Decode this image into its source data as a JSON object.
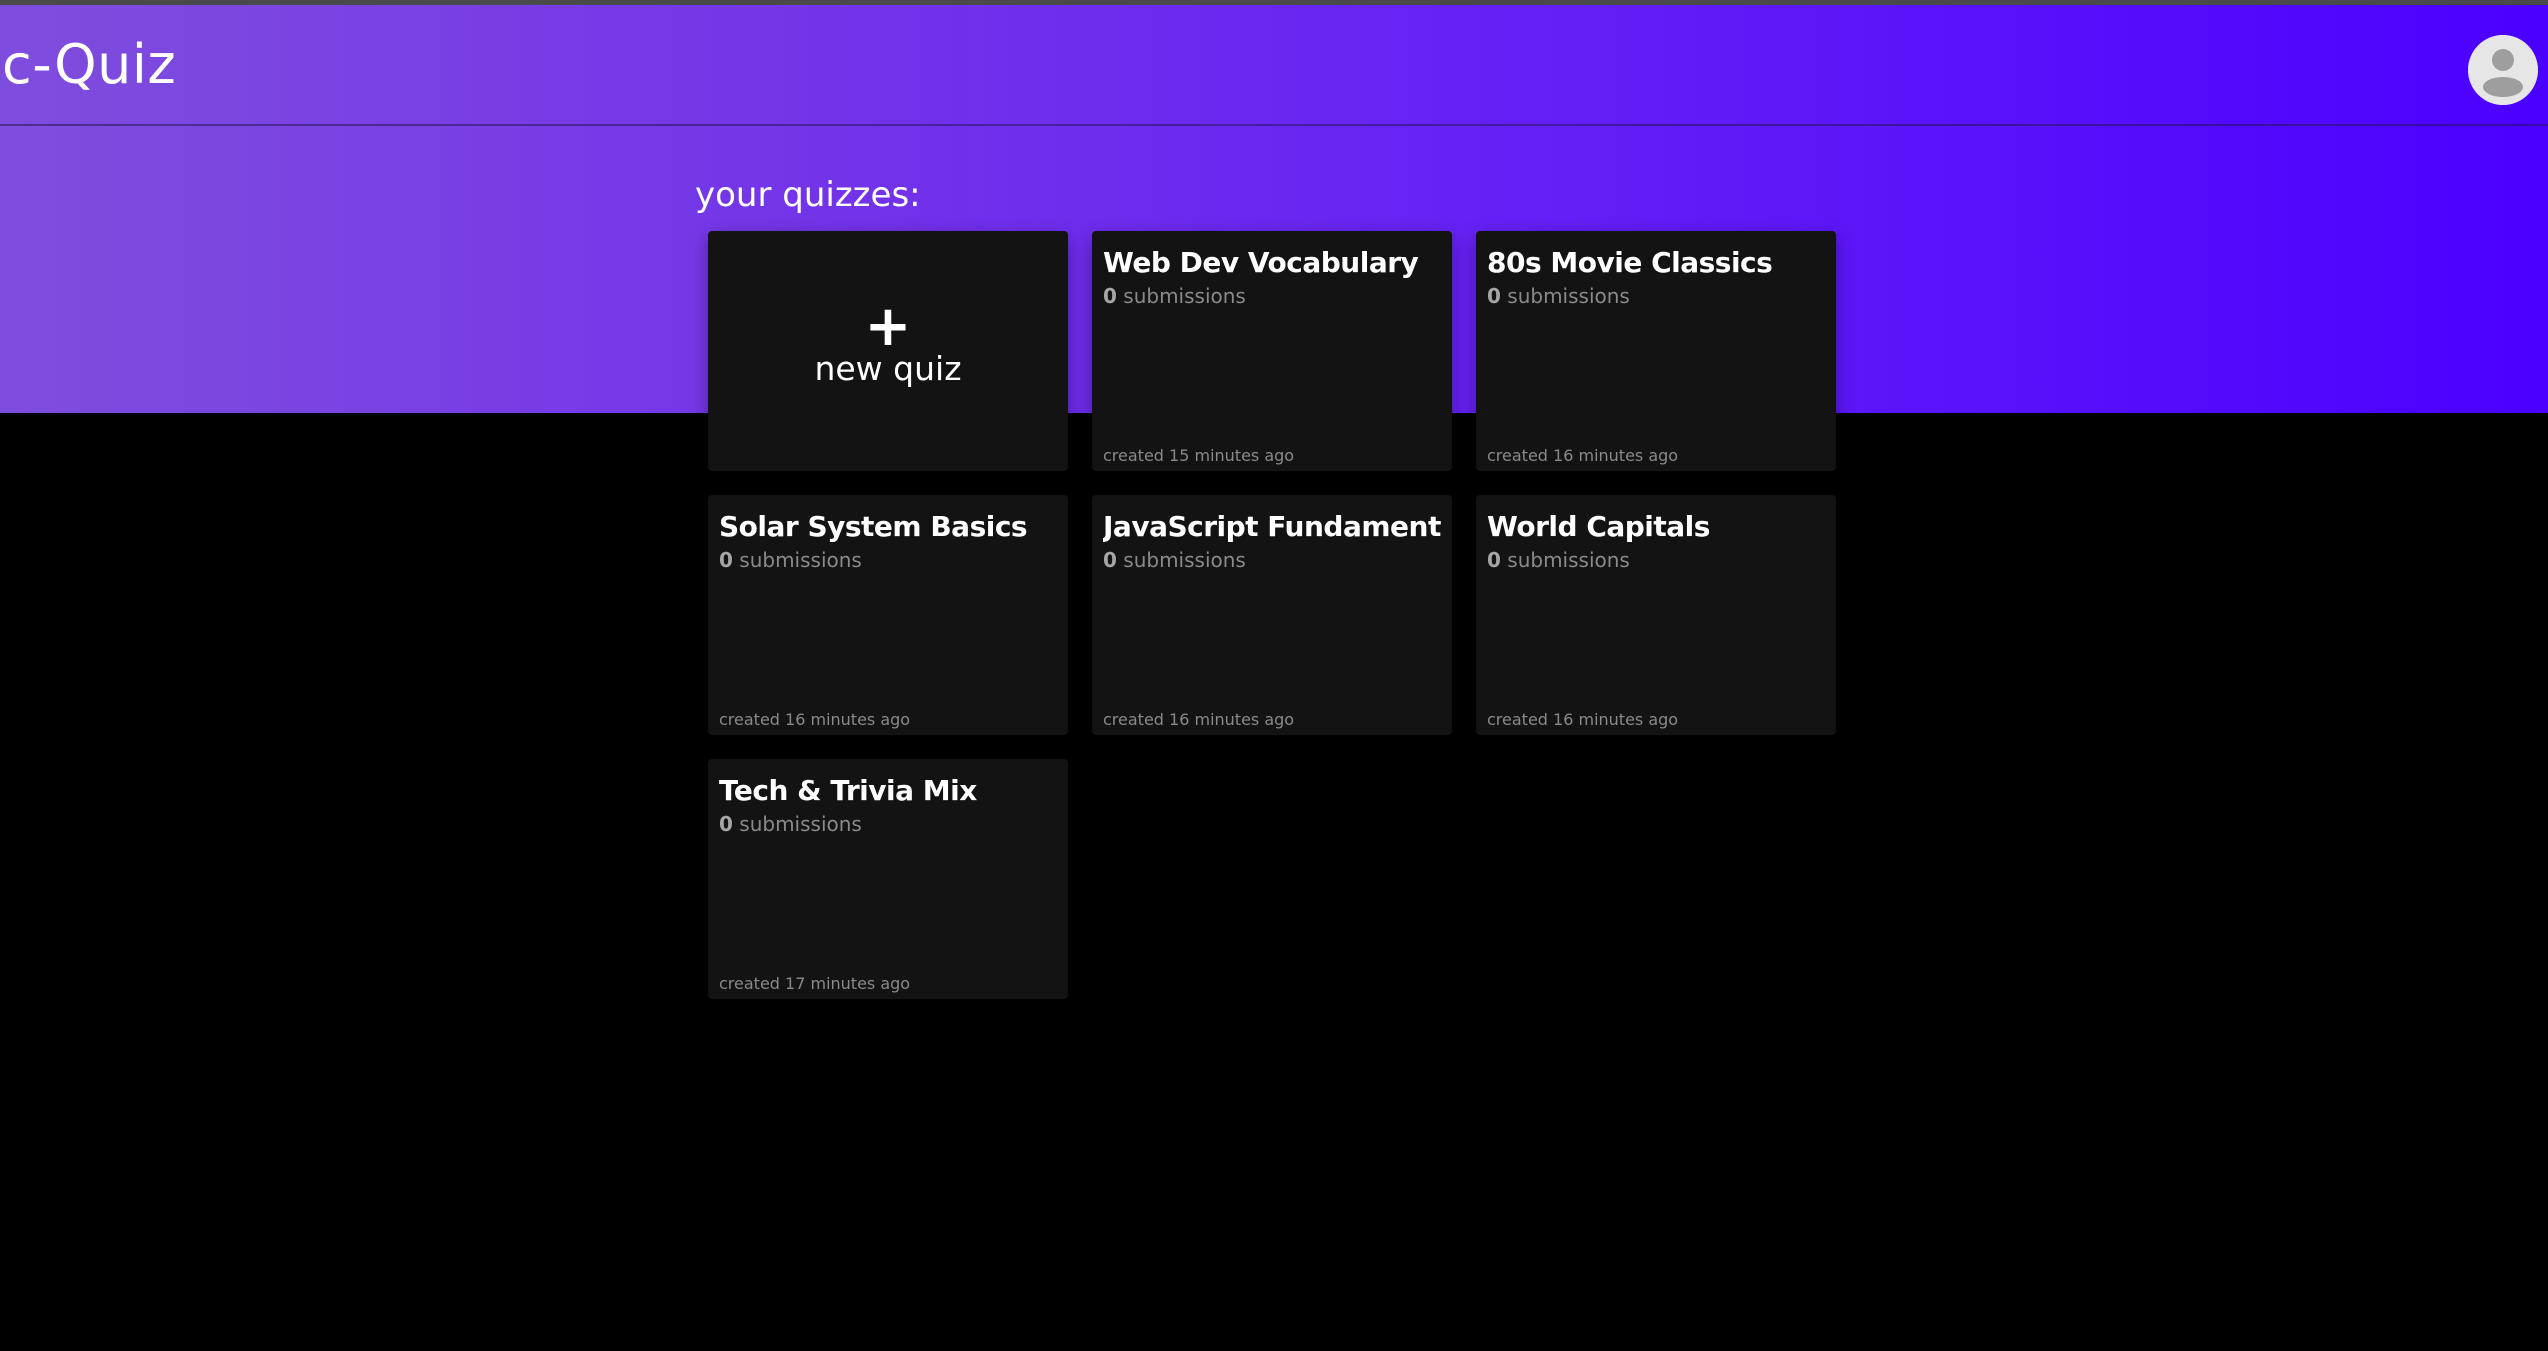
{
  "app": {
    "title": "c-Quiz"
  },
  "main": {
    "section_heading": "your quizzes:",
    "new_quiz": {
      "icon": "+",
      "label": "new quiz"
    },
    "quizzes": [
      {
        "title": "Web Dev Vocabulary",
        "submission_count": "0",
        "submissions_label": "submissions",
        "created": "created 15 minutes ago"
      },
      {
        "title": "80s Movie Classics",
        "submission_count": "0",
        "submissions_label": "submissions",
        "created": "created 16 minutes ago"
      },
      {
        "title": "Solar System Basics",
        "submission_count": "0",
        "submissions_label": "submissions",
        "created": "created 16 minutes ago"
      },
      {
        "title": "JavaScript Fundament",
        "submission_count": "0",
        "submissions_label": "submissions",
        "created": "created 16 minutes ago"
      },
      {
        "title": "World Capitals",
        "submission_count": "0",
        "submissions_label": "submissions",
        "created": "created 16 minutes ago"
      },
      {
        "title": "Tech & Trivia Mix",
        "submission_count": "0",
        "submissions_label": "submissions",
        "created": "created 17 minutes ago"
      }
    ]
  },
  "colors": {
    "gradient_start": "#7f4ddd",
    "gradient_end": "#4a00ff",
    "card_background": "#131313",
    "page_background": "#000000"
  },
  "icons": {
    "user": "user-avatar-icon",
    "add": "plus-icon"
  }
}
